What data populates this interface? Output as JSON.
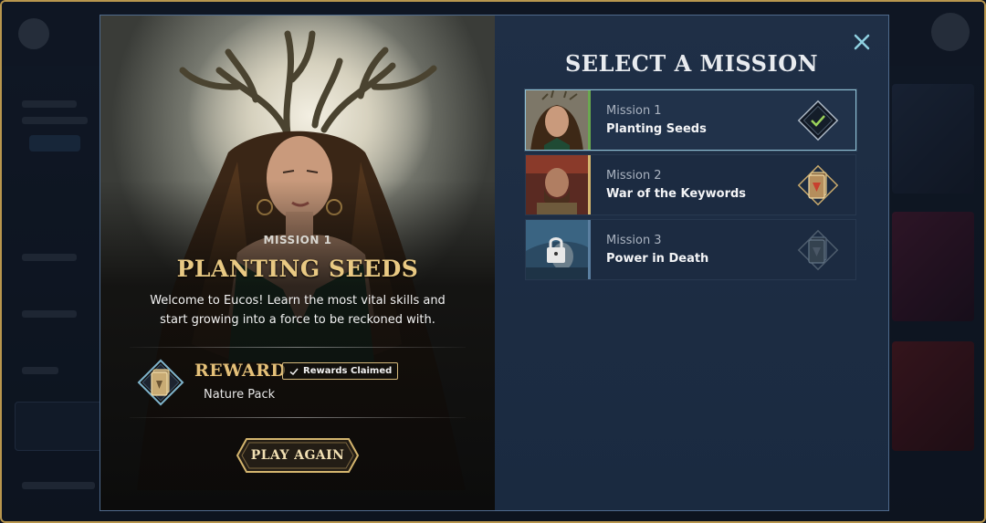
{
  "colors": {
    "accent_gold": "#e9c983",
    "accent_teal": "#8fc0d4",
    "selected_bar": "#6aa84f",
    "panel_bg": "#1b2a40"
  },
  "detail": {
    "kicker": "MISSION 1",
    "title": "PLANTING SEEDS",
    "description": "Welcome to Eucos! Learn the most vital skills and start growing into a force to be reckoned with.",
    "reward_label": "REWARD",
    "reward_badge": "Rewards Claimed",
    "reward_item": "Nature Pack",
    "play_button": "PLAY AGAIN"
  },
  "panel": {
    "title": "SELECT A MISSION",
    "close_icon": "close-icon"
  },
  "missions": [
    {
      "number": "Mission 1",
      "name": "Planting Seeds",
      "status": "completed",
      "icon": "check-diamond-icon",
      "selected": true
    },
    {
      "number": "Mission 2",
      "name": "War of the Keywords",
      "status": "reward",
      "icon": "card-pack-diamond-icon",
      "selected": false
    },
    {
      "number": "Mission 3",
      "name": "Power in Death",
      "status": "locked",
      "icon": "locked-diamond-icon",
      "selected": false
    }
  ]
}
